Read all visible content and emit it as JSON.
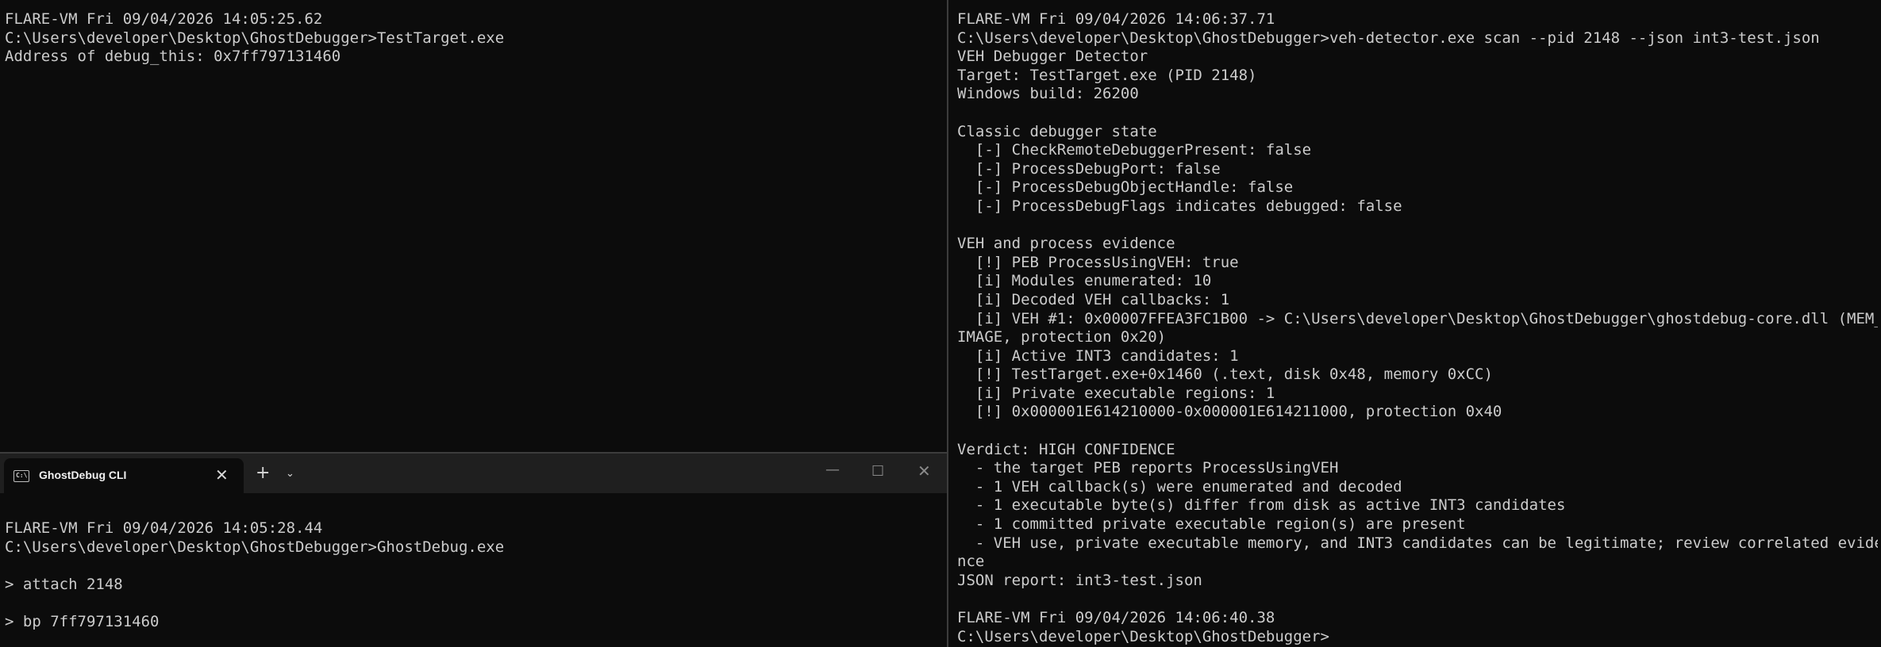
{
  "tab": {
    "icon": "terminal-icon",
    "icon_text": "C:\\",
    "title": "GhostDebug CLI",
    "close_symbol": "✕",
    "new_tab_symbol": "+",
    "dropdown_symbol": "⌄"
  },
  "window_controls": {
    "minimize": "—",
    "maximize": "☐",
    "close": "✕"
  },
  "panes": {
    "top_left": {
      "lines": [
        "FLARE-VM Fri 09/04/2026 14:05:25.62",
        "C:\\Users\\developer\\Desktop\\GhostDebugger>TestTarget.exe",
        "Address of debug_this: 0x7ff797131460"
      ]
    },
    "bottom_left": {
      "lines": [
        "FLARE-VM Fri 09/04/2026 14:05:28.44",
        "C:\\Users\\developer\\Desktop\\GhostDebugger>GhostDebug.exe",
        "",
        "> attach 2148",
        "",
        "> bp 7ff797131460"
      ]
    },
    "right": {
      "lines": [
        "FLARE-VM Fri 09/04/2026 14:06:37.71",
        "C:\\Users\\developer\\Desktop\\GhostDebugger>veh-detector.exe scan --pid 2148 --json int3-test.json",
        "VEH Debugger Detector",
        "Target: TestTarget.exe (PID 2148)",
        "Windows build: 26200",
        "",
        "Classic debugger state",
        "  [-] CheckRemoteDebuggerPresent: false",
        "  [-] ProcessDebugPort: false",
        "  [-] ProcessDebugObjectHandle: false",
        "  [-] ProcessDebugFlags indicates debugged: false",
        "",
        "VEH and process evidence",
        "  [!] PEB ProcessUsingVEH: true",
        "  [i] Modules enumerated: 10",
        "  [i] Decoded VEH callbacks: 1",
        "  [i] VEH #1: 0x00007FFEA3FC1B00 -> C:\\Users\\developer\\Desktop\\GhostDebugger\\ghostdebug-core.dll (MEM_",
        "IMAGE, protection 0x20)",
        "  [i] Active INT3 candidates: 1",
        "  [!] TestTarget.exe+0x1460 (.text, disk 0x48, memory 0xCC)",
        "  [i] Private executable regions: 1",
        "  [!] 0x000001E614210000-0x000001E614211000, protection 0x40",
        "",
        "Verdict: HIGH CONFIDENCE",
        "  - the target PEB reports ProcessUsingVEH",
        "  - 1 VEH callback(s) were enumerated and decoded",
        "  - 1 executable byte(s) differ from disk as active INT3 candidates",
        "  - 1 committed private executable region(s) are present",
        "  - VEH use, private executable memory, and INT3 candidates can be legitimate; review correlated evide",
        "nce",
        "JSON report: int3-test.json",
        "",
        "FLARE-VM Fri 09/04/2026 14:06:40.38",
        "C:\\Users\\developer\\Desktop\\GhostDebugger>"
      ]
    }
  }
}
